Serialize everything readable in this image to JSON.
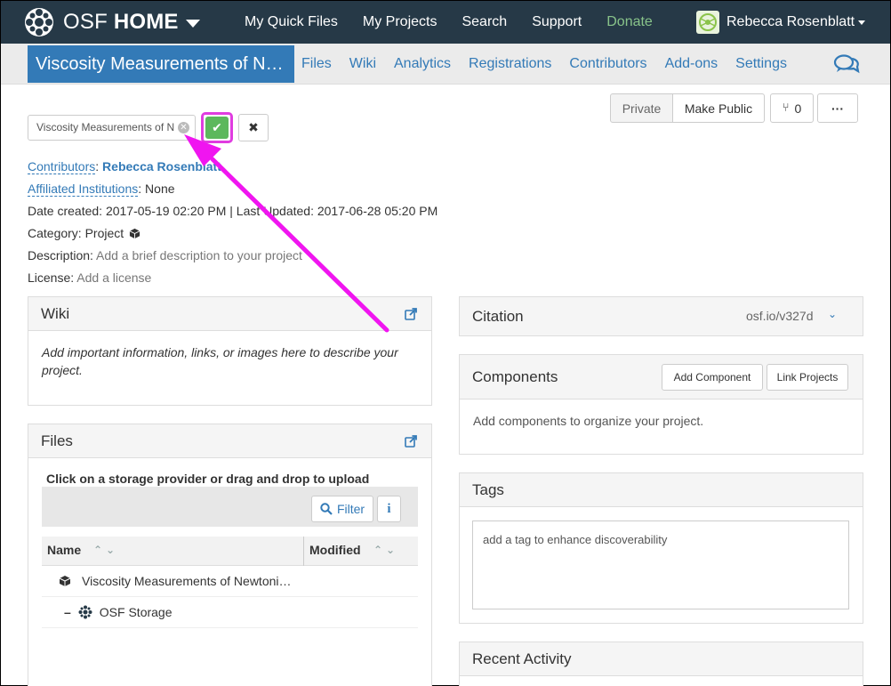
{
  "topnav": {
    "brand_osf": "OSF",
    "brand_home": "HOME",
    "items": [
      "My Quick Files",
      "My Projects",
      "Search",
      "Support",
      "Donate"
    ],
    "user_name": "Rebecca Rosenblatt"
  },
  "projnav": {
    "title": "Viscosity Measurements of N…",
    "items": [
      "Files",
      "Wiki",
      "Analytics",
      "Registrations",
      "Contributors",
      "Add-ons",
      "Settings"
    ]
  },
  "header_buttons": {
    "private": "Private",
    "make_public": "Make Public",
    "fork_count": "0",
    "more": "···"
  },
  "title_edit": {
    "value": "Viscosity Measurements of N"
  },
  "meta": {
    "contributors_label": "Contributors",
    "contributor_name": "Rebecca Rosenblatt",
    "affiliated_label": "Affiliated Institutions",
    "affiliated_value": "None",
    "dates": "Date created: 2017-05-19 02:20 PM | Last Updated: 2017-06-28 05:20 PM",
    "category_label": "Category:",
    "category_value": "Project",
    "description_label": "Description:",
    "description_value": "Add a brief description to your project",
    "license_label": "License:",
    "license_value": "Add a license"
  },
  "wiki": {
    "title": "Wiki",
    "body": "Add important information, links, or images here to describe your project."
  },
  "files": {
    "title": "Files",
    "instruction": "Click on a storage provider or drag and drop to upload",
    "filter_label": "Filter",
    "col_name": "Name",
    "col_modified": "Modified",
    "rows": [
      "Viscosity Measurements of Newtoni…",
      "OSF Storage"
    ]
  },
  "citation": {
    "title": "Citation",
    "link": "osf.io/v327d"
  },
  "components": {
    "title": "Components",
    "add_component": "Add Component",
    "link_projects": "Link Projects",
    "body": "Add components to organize your project."
  },
  "tags": {
    "title": "Tags",
    "placeholder": "add a tag to enhance discoverability"
  },
  "recent_activity": {
    "title": "Recent Activity"
  },
  "colors": {
    "nav_bg": "#263947",
    "primary": "#337ab7",
    "donate": "#88c38a",
    "success": "#5cb85c",
    "highlight": "#e03ce0"
  }
}
